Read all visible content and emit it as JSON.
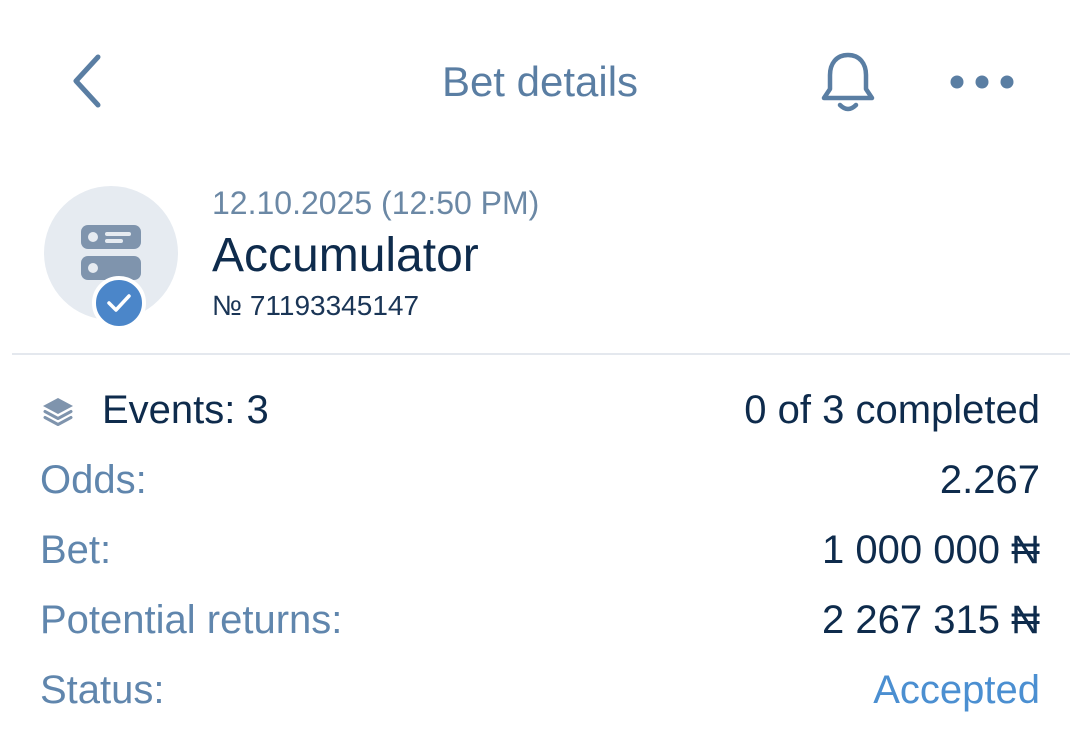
{
  "header": {
    "title": "Bet details",
    "back_icon": "chevron-left-icon",
    "bell_icon": "bell-icon",
    "more_icon": "more-horizontal-icon"
  },
  "bet": {
    "date": "12.10.2025 (12:50 PM)",
    "type": "Accumulator",
    "number": "№ 71193345147",
    "icon": "accumulator-icon",
    "badge_icon": "check-icon"
  },
  "details": {
    "events_label": "Events: 3",
    "events_value": "0 of 3 completed",
    "events_icon": "layers-icon",
    "odds_label": "Odds:",
    "odds_value": "2.267",
    "bet_label": "Bet:",
    "bet_value": "1 000 000 ₦",
    "returns_label": "Potential returns:",
    "returns_value": "2 267 315 ₦",
    "status_label": "Status:",
    "status_value": "Accepted"
  },
  "colors": {
    "accent": "#5a7ea3",
    "text_dark": "#0e2b4c",
    "label": "#6086ad",
    "status_accepted": "#4b8fd1",
    "badge": "#4b86c9",
    "icon_bg": "#e6ebf1"
  }
}
